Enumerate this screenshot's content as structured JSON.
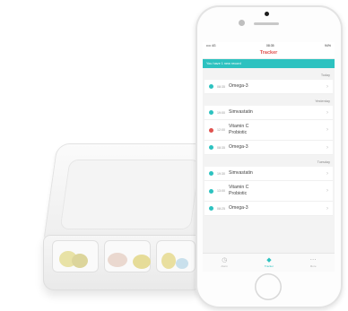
{
  "status_bar": {
    "carrier": "•••• 4G",
    "time": "08:35",
    "battery": "94%"
  },
  "app": {
    "title": "Tracker"
  },
  "banner": {
    "text": "You have 1 new record"
  },
  "days": [
    {
      "label": "Today",
      "items": [
        {
          "time": "08:35",
          "names": [
            "Omega-3"
          ],
          "status": "taken"
        }
      ]
    },
    {
      "label": "Yesterday",
      "items": [
        {
          "time": "19:00",
          "names": [
            "Simvastatin"
          ],
          "status": "taken"
        },
        {
          "time": "12:00",
          "names": [
            "Vitamin C",
            "Probiotic"
          ],
          "status": "missed"
        },
        {
          "time": "08:35",
          "names": [
            "Omega-3"
          ],
          "status": "taken"
        }
      ]
    },
    {
      "label": "Tuesday",
      "items": [
        {
          "time": "19:30",
          "names": [
            "Simvastatin"
          ],
          "status": "taken"
        },
        {
          "time": "13:00",
          "names": [
            "Vitamin C",
            "Probiotic"
          ],
          "status": "taken"
        },
        {
          "time": "08:25",
          "names": [
            "Omega-3"
          ],
          "status": "taken"
        }
      ]
    }
  ],
  "tabs": [
    {
      "label": "Alarm",
      "icon": "clock-icon",
      "active": false
    },
    {
      "label": "Tracker",
      "icon": "pill-icon",
      "active": true
    },
    {
      "label": "More",
      "icon": "more-icon",
      "active": false
    }
  ],
  "colors": {
    "accent": "#2dc2c0",
    "title": "#e0524f",
    "taken": "#2dc2c0",
    "missed": "#e0524f"
  }
}
